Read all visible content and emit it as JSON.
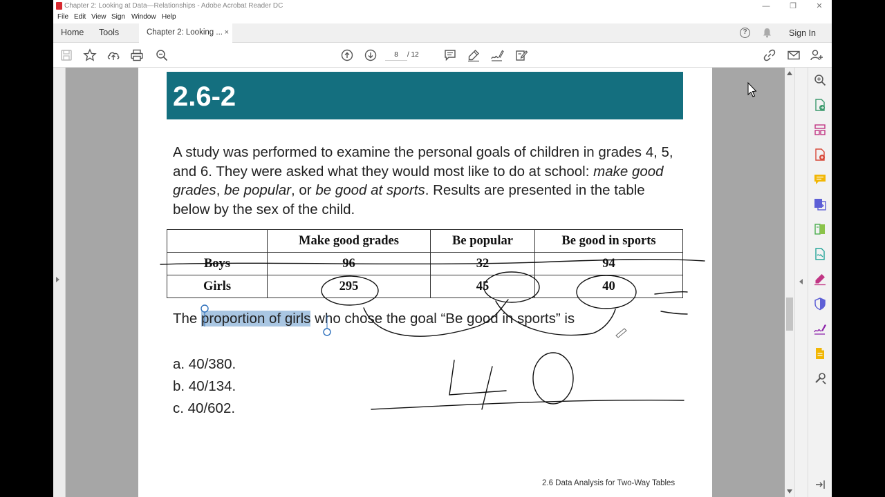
{
  "window": {
    "title": "Chapter 2: Looking at Data—Relationships - Adobe Acrobat Reader DC",
    "minimize": "—",
    "restore": "❐",
    "close": "✕"
  },
  "menu": [
    "File",
    "Edit",
    "View",
    "Sign",
    "Window",
    "Help"
  ],
  "tabs": {
    "home": "Home",
    "tools": "Tools",
    "document": "Chapter 2: Looking ...",
    "close": "×"
  },
  "header": {
    "sign_in": "Sign In",
    "help": "?"
  },
  "toolbar": {
    "page_current": "8",
    "page_total": "/ 12"
  },
  "document": {
    "banner_title": "2.6-2",
    "question_parts": [
      "A study was performed to examine the personal goals of children in grades 4, 5, and 6. They were asked what they would most like to do at school: ",
      "make good grades",
      ", ",
      "be popular",
      ", or ",
      "be good at sports",
      ". Results are presented in the table below by the sex of the child."
    ],
    "table": {
      "headers": [
        "",
        "Make good grades",
        "Be popular",
        "Be good in sports"
      ],
      "rows": [
        [
          "Boys",
          "96",
          "32",
          "94"
        ],
        [
          "Girls",
          "295",
          "45",
          "40"
        ]
      ]
    },
    "prompt": {
      "before": "The ",
      "highlight": "proportion of girls",
      "after": " who chose the goal “Be good in sports” is"
    },
    "options": [
      "a. 40/380.",
      "b. 40/134.",
      "c. 40/602."
    ],
    "footer": "2.6 Data Analysis for Two-Way Tables"
  },
  "icons": {
    "toolbar": [
      "save-icon",
      "bookmark-star-icon",
      "upload-icon",
      "print-icon",
      "zoom-out-icon",
      "page-up-icon",
      "page-down-icon",
      "comment-icon",
      "highlight-pen-icon",
      "sign-icon",
      "fill-sign-icon",
      "share-link-icon",
      "email-icon",
      "add-user-icon"
    ],
    "right_panel": [
      "zoom-in-icon",
      "export-pdf-icon",
      "organize-pages-icon",
      "create-pdf-icon",
      "comment-tool-icon",
      "combine-files-icon",
      "compress-pdf-icon",
      "send-for-signature-icon",
      "fill-and-sign-icon",
      "protect-icon",
      "edit-pdf-icon",
      "scan-icon",
      "more-tools-icon",
      "collapse-panel-icon"
    ]
  },
  "colors": {
    "banner": "#146f7f",
    "highlight": "#a9c6e2",
    "viewer_bg": "#a6a6a6"
  }
}
